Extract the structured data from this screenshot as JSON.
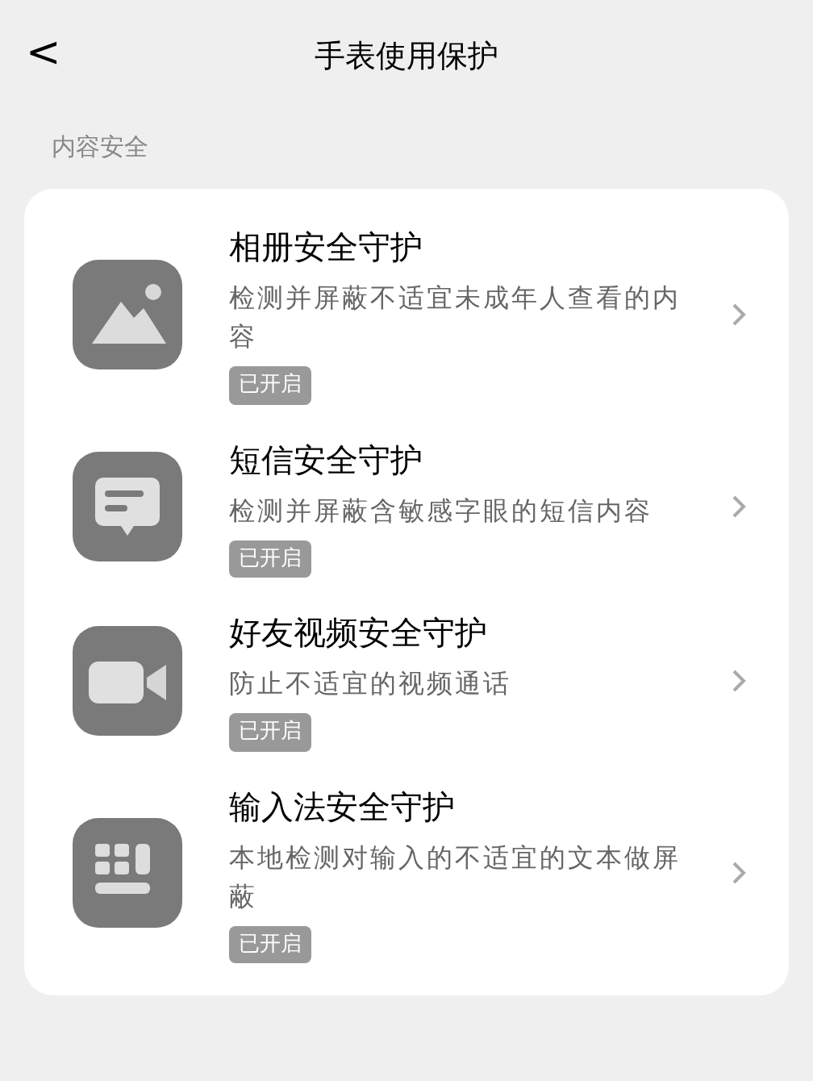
{
  "header": {
    "back": "<",
    "title": "手表使用保护"
  },
  "section": {
    "label": "内容安全"
  },
  "items": [
    {
      "kind": "photo",
      "title": "相册安全守护",
      "description": "检测并屏蔽不适宜未成年人查看的内容",
      "status": "已开启"
    },
    {
      "kind": "message",
      "title": "短信安全守护",
      "description": "检测并屏蔽含敏感字眼的短信内容",
      "status": "已开启"
    },
    {
      "kind": "video",
      "title": "好友视频安全守护",
      "description": "防止不适宜的视频通话",
      "status": "已开启"
    },
    {
      "kind": "keyboard",
      "title": "输入法安全守护",
      "description": "本地检测对输入的不适宜的文本做屏蔽",
      "status": "已开启"
    }
  ]
}
